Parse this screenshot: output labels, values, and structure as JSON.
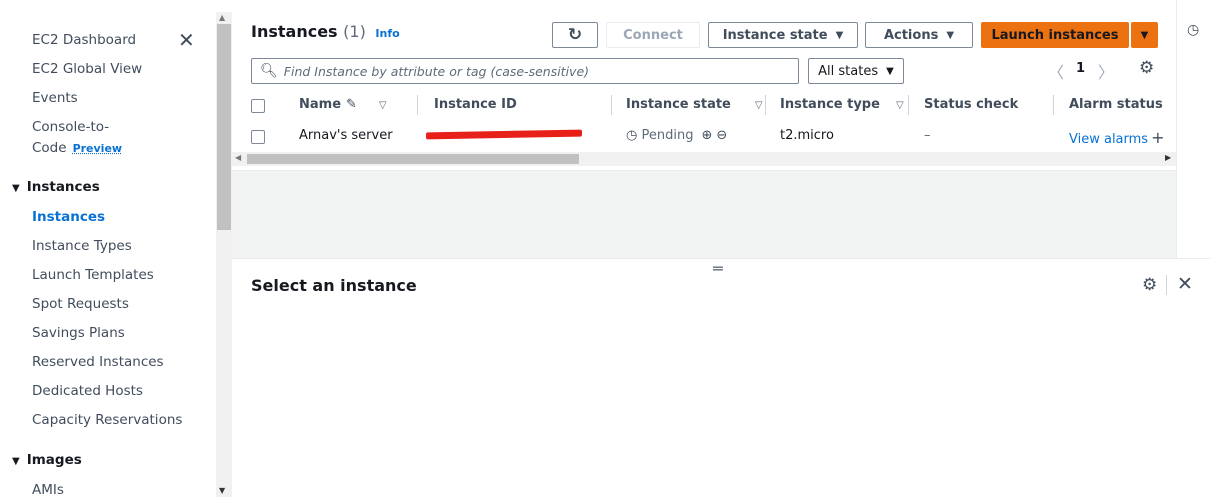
{
  "sidebar": {
    "close_icon": "close-icon",
    "items_top": [
      "EC2 Dashboard",
      "EC2 Global View",
      "Events"
    ],
    "console_to_code": {
      "line1": "Console-to-",
      "line2": "Code",
      "badge": "Preview"
    },
    "instances_section": {
      "title": "Instances",
      "items": [
        "Instances",
        "Instance Types",
        "Launch Templates",
        "Spot Requests",
        "Savings Plans",
        "Reserved Instances",
        "Dedicated Hosts",
        "Capacity Reservations"
      ],
      "active_index": 0
    },
    "images_section": {
      "title": "Images",
      "items": [
        "AMIs"
      ]
    }
  },
  "header": {
    "title": "Instances",
    "count": "(1)",
    "info": "Info",
    "refresh_icon": "refresh-icon",
    "connect": "Connect",
    "instance_state": "Instance state",
    "actions": "Actions",
    "launch": "Launch instances"
  },
  "filter": {
    "placeholder": "Find Instance by attribute or tag (case-sensitive)",
    "states": "All states",
    "page": "1"
  },
  "table": {
    "columns": [
      "Name",
      "Instance ID",
      "Instance state",
      "Instance type",
      "Status check",
      "Alarm status"
    ],
    "rows": [
      {
        "name": "Arnav's server",
        "state": "Pending",
        "type": "t2.micro",
        "status_check": "–",
        "alarm": "View alarms"
      }
    ]
  },
  "detail": {
    "title": "Select an instance"
  },
  "colors": {
    "accent": "#0972d3",
    "primary": "#ec7211",
    "redaction": "#e8201a"
  }
}
